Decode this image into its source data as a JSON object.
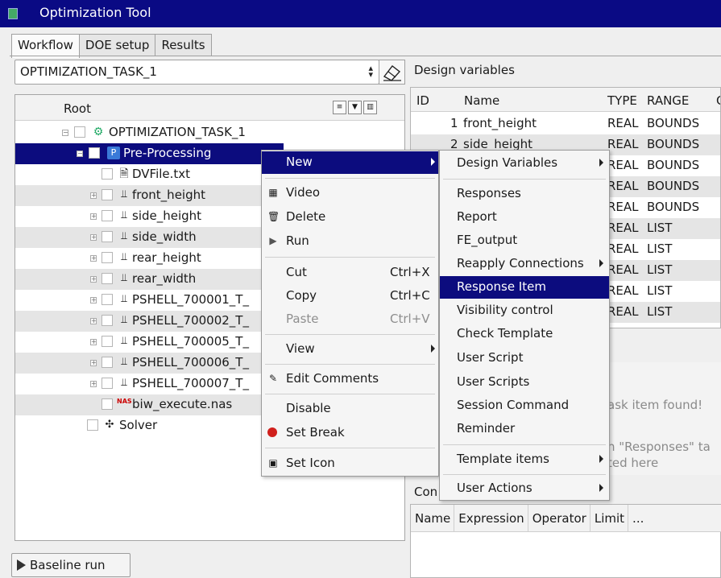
{
  "window": {
    "title": "Optimization Tool"
  },
  "tabs": [
    {
      "label": "Workflow",
      "active": true
    },
    {
      "label": "DOE setup",
      "active": false
    },
    {
      "label": "Results",
      "active": false
    }
  ],
  "task_selector": {
    "value": "OPTIMIZATION_TASK_1"
  },
  "tree": {
    "header": "Root",
    "nodes": [
      {
        "label": "OPTIMIZATION_TASK_1",
        "icon": "task-icon"
      },
      {
        "label": "Pre-Processing",
        "icon": "preprocessing-icon"
      },
      {
        "label": "DVFile.txt",
        "icon": "file-icon"
      },
      {
        "label": "front_height",
        "icon": "variable-icon"
      },
      {
        "label": "side_height",
        "icon": "variable-icon"
      },
      {
        "label": "side_width",
        "icon": "variable-icon"
      },
      {
        "label": "rear_height",
        "icon": "variable-icon"
      },
      {
        "label": "rear_width",
        "icon": "variable-icon"
      },
      {
        "label": "PSHELL_700001_T_",
        "icon": "variable-icon"
      },
      {
        "label": "PSHELL_700002_T_",
        "icon": "variable-icon"
      },
      {
        "label": "PSHELL_700005_T_",
        "icon": "variable-icon"
      },
      {
        "label": "PSHELL_700006_T_",
        "icon": "variable-icon"
      },
      {
        "label": "PSHELL_700007_T_",
        "icon": "variable-icon"
      },
      {
        "label": "biw_execute.nas",
        "icon": "nas-file-icon",
        "icon_text": "NAS"
      },
      {
        "label": "Solver",
        "icon": "solver-icon"
      }
    ]
  },
  "baseline": {
    "label": "Baseline run"
  },
  "design_variables": {
    "title": "Design variables",
    "headers": [
      "ID",
      "Name",
      "TYPE",
      "RANGE",
      "C"
    ],
    "rows": [
      {
        "id": "1",
        "name": "front_height",
        "type": "REAL",
        "range": "BOUNDS"
      },
      {
        "id": "2",
        "name": "side_height",
        "type": "REAL",
        "range": "BOUNDS"
      },
      {
        "type": "REAL",
        "range": "BOUNDS"
      },
      {
        "type": "REAL",
        "range": "BOUNDS"
      },
      {
        "type": "REAL",
        "range": "BOUNDS"
      },
      {
        "type": "REAL",
        "range": "LIST"
      },
      {
        "type": "REAL",
        "range": "LIST"
      },
      {
        "type": "REAL",
        "range": "LIST"
      },
      {
        "type": "REAL",
        "range": "LIST"
      },
      {
        "type": "REAL",
        "range": "LIST"
      }
    ]
  },
  "responses_panel": {
    "msg1": "ask item found!",
    "msg2": "n \"Responses\" ta",
    "msg3": "ted here"
  },
  "constraints": {
    "title": "Con",
    "headers": [
      "Name",
      "Expression",
      "Operator",
      "Limit",
      "..."
    ]
  },
  "context_menu": {
    "items": [
      {
        "label": "New",
        "submenu": true,
        "highlighted": true
      },
      {
        "label": "Video",
        "icon": "video-icon"
      },
      {
        "label": "Delete",
        "icon": "trash-icon"
      },
      {
        "label": "Run",
        "icon": "run-icon"
      },
      {
        "label": "Cut",
        "shortcut": "Ctrl+X"
      },
      {
        "label": "Copy",
        "shortcut": "Ctrl+C"
      },
      {
        "label": "Paste",
        "shortcut": "Ctrl+V",
        "disabled": true
      },
      {
        "label": "View",
        "submenu": true
      },
      {
        "label": "Edit Comments",
        "icon": "pencil-icon"
      },
      {
        "label": "Disable"
      },
      {
        "label": "Set Break",
        "icon": "stop-icon"
      },
      {
        "label": "Set Icon",
        "icon": "image-icon"
      }
    ]
  },
  "submenu": {
    "items": [
      {
        "label": "Design Variables",
        "submenu": true
      },
      {
        "label": "Responses"
      },
      {
        "label": "Report"
      },
      {
        "label": "FE_output"
      },
      {
        "label": "Reapply Connections",
        "submenu": true
      },
      {
        "label": "Response Item",
        "highlighted": true
      },
      {
        "label": "Visibility control"
      },
      {
        "label": "Check Template"
      },
      {
        "label": "User Script"
      },
      {
        "label": "User Scripts"
      },
      {
        "label": "Session Command"
      },
      {
        "label": "Reminder"
      },
      {
        "label": "Template items",
        "submenu": true
      },
      {
        "label": "User Actions",
        "submenu": true
      }
    ]
  },
  "colors": {
    "selection": "#0c0c7e",
    "titlebar": "#0a0a84"
  }
}
